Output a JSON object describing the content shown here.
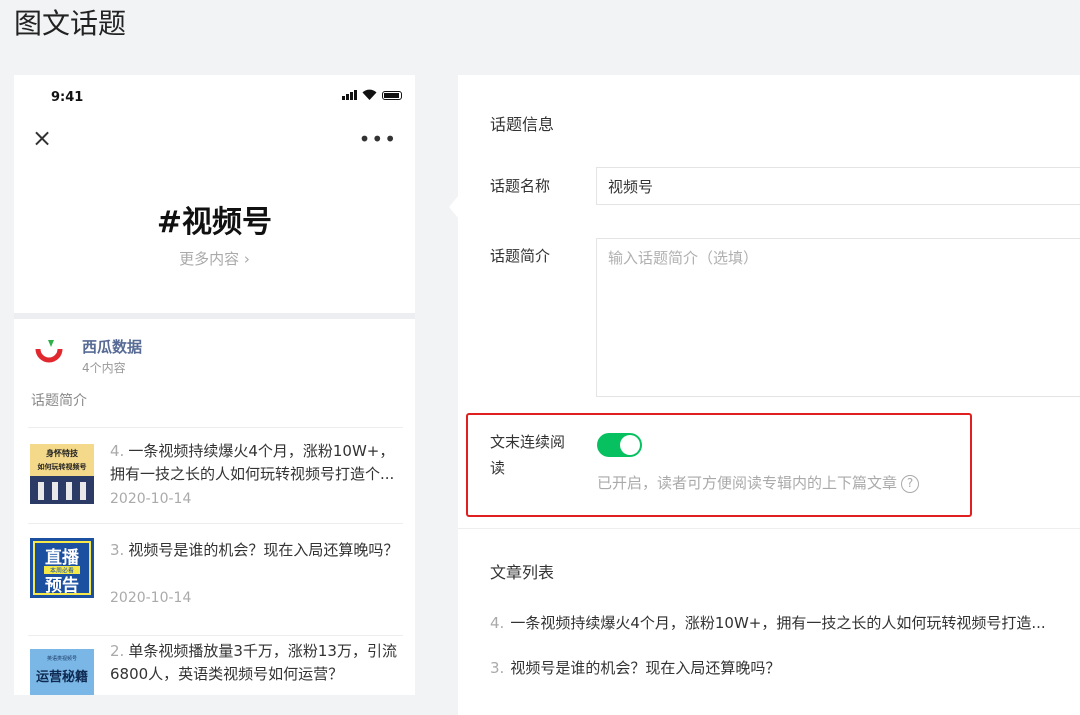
{
  "page_title": "图文话题",
  "phone": {
    "status_time": "9:41",
    "hashtag": "#视频号",
    "more_content": "更多内容",
    "account": {
      "name": "西瓜数据",
      "count": "4个内容"
    },
    "intro_label": "话题简介",
    "articles": [
      {
        "num": "4.",
        "title": "一条视频持续爆火4个月，涨粉10W+，拥有一技之长的人如何玩转视频号打造个...",
        "date": "2020-10-14",
        "thumb": {
          "line1": "身怀特技",
          "line2": "如何玩转视频号"
        }
      },
      {
        "num": "3.",
        "title": "视频号是谁的机会？现在入局还算晚吗？",
        "date": "2020-10-14",
        "thumb": {
          "line1": "直播",
          "line2": "预告",
          "tag": "本周必看"
        }
      },
      {
        "num": "2.",
        "title": "单条视频播放量3千万，涨粉13万，引流6800人，英语类视频号如何运营？",
        "date": "",
        "thumb": {
          "line1": "英语类视频号",
          "line2": "运营秘籍"
        }
      }
    ]
  },
  "form": {
    "section_info": "话题信息",
    "name_label": "话题名称",
    "name_value": "视频号",
    "intro_label": "话题简介",
    "intro_placeholder": "输入话题简介（选填）",
    "continuous_label": "文末连续阅读",
    "continuous_enabled": true,
    "continuous_hint": "已开启，读者可方便阅读专辑内的上下篇文章",
    "section_list": "文章列表",
    "list": [
      {
        "num": "4.",
        "title": "一条视频持续爆火4个月，涨粉10W+，拥有一技之长的人如何玩转视频号打造..."
      },
      {
        "num": "3.",
        "title": "视频号是谁的机会？现在入局还算晚吗？"
      }
    ]
  },
  "colors": {
    "accent_green": "#07c160",
    "link_blue": "#576b95",
    "highlight_red": "#e02020"
  },
  "icons": [
    "close-icon",
    "more-icon",
    "chevron-right-icon",
    "help-icon",
    "signal-icon",
    "wifi-icon",
    "battery-icon"
  ]
}
